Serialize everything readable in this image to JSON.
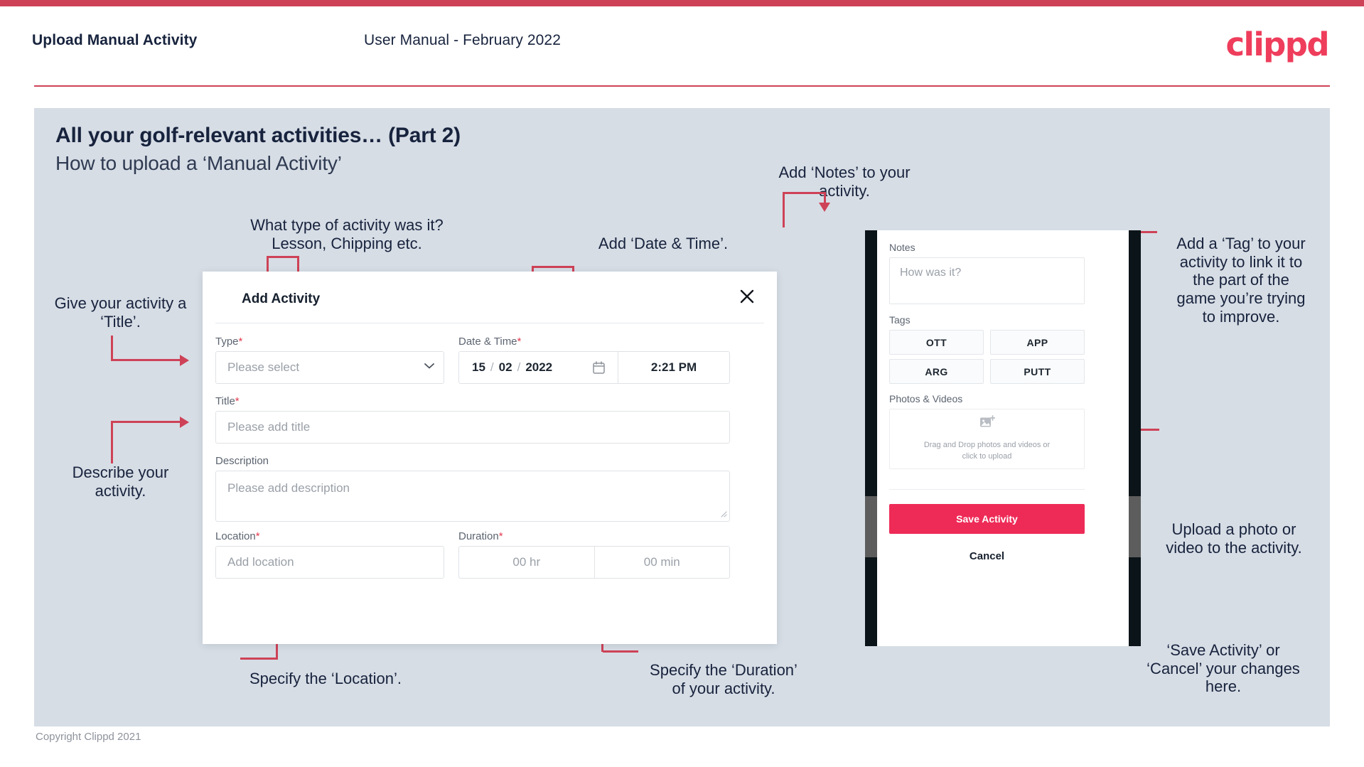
{
  "header": {
    "title": "Upload Manual Activity",
    "subtitle": "User Manual - February 2022",
    "logo": "clippd"
  },
  "slide": {
    "title": "All your golf-relevant activities… (Part 2)",
    "subtitle": "How to upload a ‘Manual Activity’"
  },
  "footer": {
    "copyright": "Copyright Clippd 2021"
  },
  "colors": {
    "accent": "#ce4257",
    "logo": "#ef3d5c",
    "save_button": "#ee2b57",
    "slide_bg": "#d7dde5",
    "text": "#17233d",
    "required": "#e23b4e"
  },
  "dialog": {
    "title": "Add Activity",
    "close_icon": "close-icon",
    "fields": {
      "type": {
        "label": "Type",
        "required": "*",
        "placeholder": "Please select",
        "icon": "chevron-down-icon"
      },
      "datetime": {
        "label": "Date & Time",
        "required": "*",
        "day": "15",
        "month": "02",
        "year": "2022",
        "sep": "/",
        "calendar_icon": "calendar-icon",
        "time": "2:21 PM"
      },
      "title": {
        "label": "Title",
        "required": "*",
        "placeholder": "Please add title"
      },
      "description": {
        "label": "Description",
        "required": "",
        "placeholder": "Please add description"
      },
      "location": {
        "label": "Location",
        "required": "*",
        "placeholder": "Add location"
      },
      "duration": {
        "label": "Duration",
        "required": "*",
        "hours_placeholder": "00 hr",
        "minutes_placeholder": "00 min"
      }
    }
  },
  "phone": {
    "notes": {
      "label": "Notes",
      "placeholder": "How was it?"
    },
    "tags": {
      "label": "Tags",
      "items": [
        "OTT",
        "APP",
        "ARG",
        "PUTT"
      ]
    },
    "photos": {
      "label": "Photos & Videos",
      "icon": "add-image-icon",
      "dropzone_text": "Drag and Drop photos and videos or\nclick to upload"
    },
    "save_label": "Save Activity",
    "cancel_label": "Cancel"
  },
  "annotations": {
    "title_note": "Give your activity a\n‘Title’.",
    "describe_note": "Describe your\nactivity.",
    "type_note": "What type of activity was it?\nLesson, Chipping etc.",
    "datetime_note": "Add ‘Date & Time’.",
    "location_note": "Specify the ‘Location’.",
    "duration_note": "Specify the ‘Duration’\nof your activity.",
    "notes_note": "Add ‘Notes’ to your\nactivity.",
    "tag_note": "Add a ‘Tag’ to your\nactivity to link it to\nthe part of the\ngame you’re trying\nto improve.",
    "upload_note": "Upload a photo or\nvideo to the activity.",
    "save_cancel_note": "‘Save Activity’ or\n‘Cancel’ your changes\nhere."
  }
}
